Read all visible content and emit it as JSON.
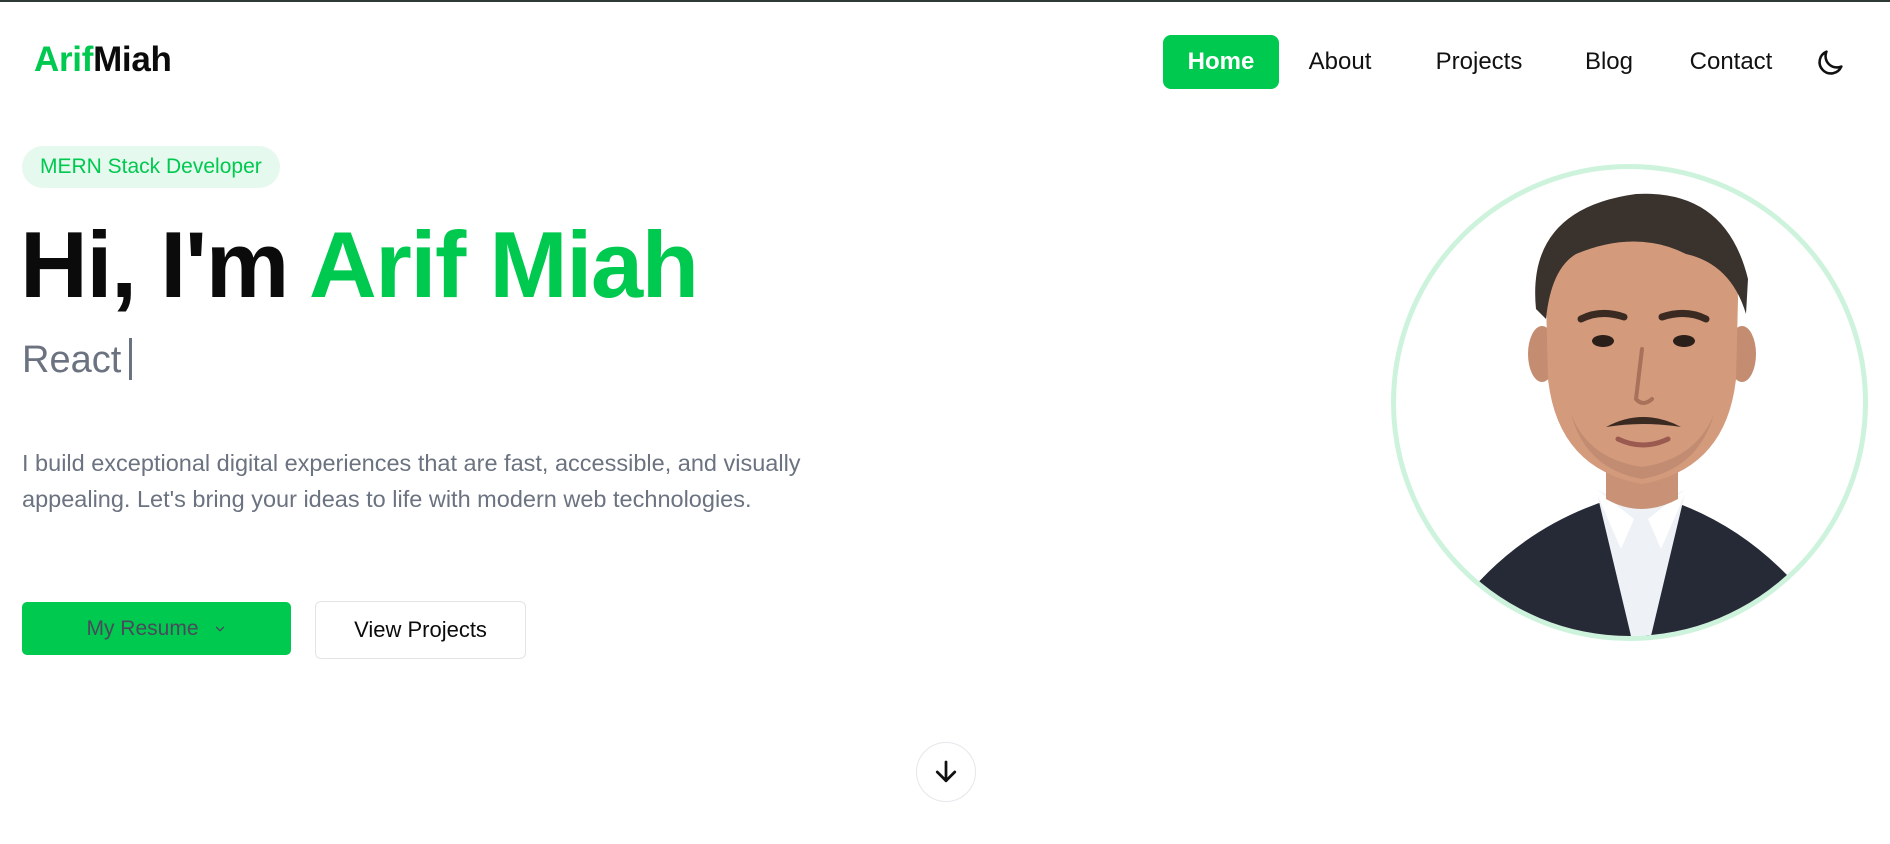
{
  "logo": {
    "first": "Arif",
    "second": "Miah"
  },
  "nav": {
    "items": [
      {
        "label": "Home",
        "active": true
      },
      {
        "label": "About",
        "active": false
      },
      {
        "label": "Projects",
        "active": false
      },
      {
        "label": "Blog",
        "active": false
      },
      {
        "label": "Contact",
        "active": false
      }
    ],
    "theme_toggle_icon": "moon-icon"
  },
  "hero": {
    "badge": "MERN Stack Developer",
    "greeting": "Hi, I'm ",
    "name": "Arif Miah",
    "typed_text": "React",
    "description": "I build exceptional digital experiences that are fast, accessible, and visually appealing. Let's bring your ideas to life with modern web technologies.",
    "resume_button": "My Resume",
    "projects_button": "View Projects",
    "scroll_icon": "arrow-down-icon",
    "avatar_icon": "profile-photo"
  },
  "colors": {
    "accent": "#00c950",
    "badge_bg": "#e6f9ee",
    "ring": "#cdf3dc",
    "text_muted": "#6b7280",
    "text_dark": "#0b0b0b"
  }
}
